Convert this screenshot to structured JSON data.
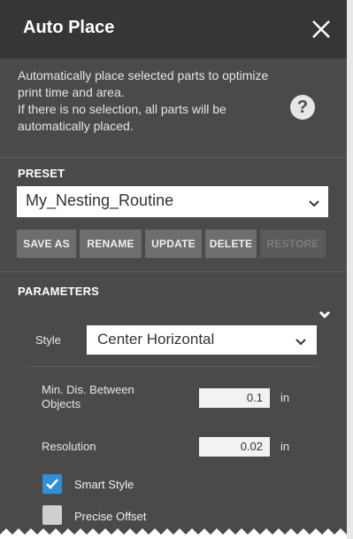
{
  "dialog": {
    "title": "Auto Place",
    "description": "Automatically place selected parts to optimize print time and area.\nIf there is no selection, all parts will be automatically placed.",
    "help_icon": "?"
  },
  "preset": {
    "section_label": "PRESET",
    "selected": "My_Nesting_Routine",
    "buttons": {
      "save_as": "SAVE AS",
      "rename": "RENAME",
      "update": "UPDATE",
      "delete": "DELETE",
      "restore": "RESTORE"
    }
  },
  "parameters": {
    "section_label": "PARAMETERS",
    "style_label": "Style",
    "style_value": "Center Horizontal",
    "min_dis_label": "Min. Dis. Between Objects",
    "min_dis_value": "0.1",
    "min_dis_unit": "in",
    "resolution_label": "Resolution",
    "resolution_value": "0.02",
    "resolution_unit": "in",
    "smart_style_label": "Smart Style",
    "smart_style_checked": true,
    "precise_offset_label": "Precise Offset",
    "precise_offset_checked": false
  },
  "colors": {
    "panel": "#4a4a4a",
    "title_bar": "#363636",
    "accent": "#2f8fd8"
  }
}
